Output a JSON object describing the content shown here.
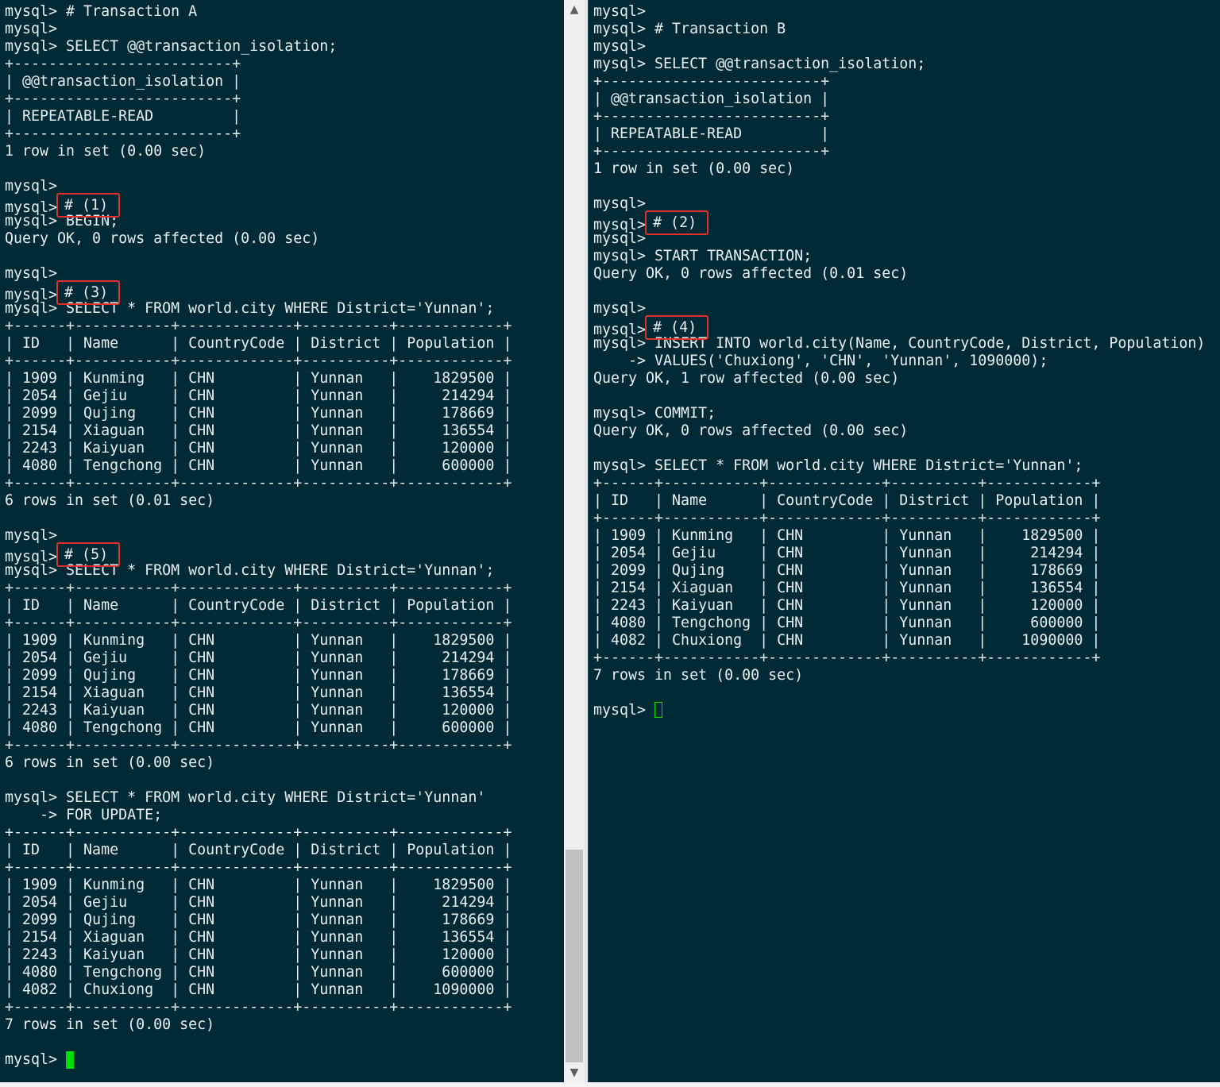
{
  "left_terminal": {
    "lines": [
      {
        "t": "mysql> # Transaction A"
      },
      {
        "t": "mysql>"
      },
      {
        "t": "mysql> SELECT @@transaction_isolation;"
      },
      {
        "t": "+-------------------------+"
      },
      {
        "t": "| @@transaction_isolation |"
      },
      {
        "t": "+-------------------------+"
      },
      {
        "t": "| REPEATABLE-READ         |"
      },
      {
        "t": "+-------------------------+"
      },
      {
        "t": "1 row in set (0.00 sec)"
      },
      {
        "t": ""
      },
      {
        "t": "mysql>"
      },
      {
        "t": "mysql>",
        "marker": "# (1)"
      },
      {
        "t": "mysql> BEGIN;"
      },
      {
        "t": "Query OK, 0 rows affected (0.00 sec)"
      },
      {
        "t": ""
      },
      {
        "t": "mysql>"
      },
      {
        "t": "mysql>",
        "marker": "# (3)"
      },
      {
        "t": "mysql> SELECT * FROM world.city WHERE District='Yunnan';"
      },
      {
        "t": "+------+-----------+-------------+----------+------------+"
      },
      {
        "t": "| ID   | Name      | CountryCode | District | Population |"
      },
      {
        "t": "+------+-----------+-------------+----------+------------+"
      },
      {
        "t": "| 1909 | Kunming   | CHN         | Yunnan   |    1829500 |"
      },
      {
        "t": "| 2054 | Gejiu     | CHN         | Yunnan   |     214294 |"
      },
      {
        "t": "| 2099 | Qujing    | CHN         | Yunnan   |     178669 |"
      },
      {
        "t": "| 2154 | Xiaguan   | CHN         | Yunnan   |     136554 |"
      },
      {
        "t": "| 2243 | Kaiyuan   | CHN         | Yunnan   |     120000 |"
      },
      {
        "t": "| 4080 | Tengchong | CHN         | Yunnan   |     600000 |"
      },
      {
        "t": "+------+-----------+-------------+----------+------------+"
      },
      {
        "t": "6 rows in set (0.01 sec)"
      },
      {
        "t": ""
      },
      {
        "t": "mysql>"
      },
      {
        "t": "mysql>",
        "marker": "# (5)"
      },
      {
        "t": "mysql> SELECT * FROM world.city WHERE District='Yunnan';"
      },
      {
        "t": "+------+-----------+-------------+----------+------------+"
      },
      {
        "t": "| ID   | Name      | CountryCode | District | Population |"
      },
      {
        "t": "+------+-----------+-------------+----------+------------+"
      },
      {
        "t": "| 1909 | Kunming   | CHN         | Yunnan   |    1829500 |"
      },
      {
        "t": "| 2054 | Gejiu     | CHN         | Yunnan   |     214294 |"
      },
      {
        "t": "| 2099 | Qujing    | CHN         | Yunnan   |     178669 |"
      },
      {
        "t": "| 2154 | Xiaguan   | CHN         | Yunnan   |     136554 |"
      },
      {
        "t": "| 2243 | Kaiyuan   | CHN         | Yunnan   |     120000 |"
      },
      {
        "t": "| 4080 | Tengchong | CHN         | Yunnan   |     600000 |"
      },
      {
        "t": "+------+-----------+-------------+----------+------------+"
      },
      {
        "t": "6 rows in set (0.00 sec)"
      },
      {
        "t": ""
      },
      {
        "t": "mysql> SELECT * FROM world.city WHERE District='Yunnan'"
      },
      {
        "t": "    -> FOR UPDATE;"
      },
      {
        "t": "+------+-----------+-------------+----------+------------+"
      },
      {
        "t": "| ID   | Name      | CountryCode | District | Population |"
      },
      {
        "t": "+------+-----------+-------------+----------+------------+"
      },
      {
        "t": "| 1909 | Kunming   | CHN         | Yunnan   |    1829500 |"
      },
      {
        "t": "| 2054 | Gejiu     | CHN         | Yunnan   |     214294 |"
      },
      {
        "t": "| 2099 | Qujing    | CHN         | Yunnan   |     178669 |"
      },
      {
        "t": "| 2154 | Xiaguan   | CHN         | Yunnan   |     136554 |"
      },
      {
        "t": "| 2243 | Kaiyuan   | CHN         | Yunnan   |     120000 |"
      },
      {
        "t": "| 4080 | Tengchong | CHN         | Yunnan   |     600000 |"
      },
      {
        "t": "| 4082 | Chuxiong  | CHN         | Yunnan   |    1090000 |"
      },
      {
        "t": "+------+-----------+-------------+----------+------------+"
      },
      {
        "t": "7 rows in set (0.00 sec)"
      },
      {
        "t": ""
      },
      {
        "t": "mysql> ",
        "cursor": "block"
      }
    ]
  },
  "right_terminal": {
    "lines": [
      {
        "t": "mysql>"
      },
      {
        "t": "mysql> # Transaction B"
      },
      {
        "t": "mysql>"
      },
      {
        "t": "mysql> SELECT @@transaction_isolation;"
      },
      {
        "t": "+-------------------------+"
      },
      {
        "t": "| @@transaction_isolation |"
      },
      {
        "t": "+-------------------------+"
      },
      {
        "t": "| REPEATABLE-READ         |"
      },
      {
        "t": "+-------------------------+"
      },
      {
        "t": "1 row in set (0.00 sec)"
      },
      {
        "t": ""
      },
      {
        "t": "mysql>"
      },
      {
        "t": "mysql>",
        "marker": "# (2)"
      },
      {
        "t": "mysql>"
      },
      {
        "t": "mysql> START TRANSACTION;"
      },
      {
        "t": "Query OK, 0 rows affected (0.01 sec)"
      },
      {
        "t": ""
      },
      {
        "t": "mysql>"
      },
      {
        "t": "mysql>",
        "marker": "# (4)"
      },
      {
        "t": "mysql> INSERT INTO world.city(Name, CountryCode, District, Population)"
      },
      {
        "t": "    -> VALUES('Chuxiong', 'CHN', 'Yunnan', 1090000);"
      },
      {
        "t": "Query OK, 1 row affected (0.00 sec)"
      },
      {
        "t": ""
      },
      {
        "t": "mysql> COMMIT;"
      },
      {
        "t": "Query OK, 0 rows affected (0.00 sec)"
      },
      {
        "t": ""
      },
      {
        "t": "mysql> SELECT * FROM world.city WHERE District='Yunnan';"
      },
      {
        "t": "+------+-----------+-------------+----------+------------+"
      },
      {
        "t": "| ID   | Name      | CountryCode | District | Population |"
      },
      {
        "t": "+------+-----------+-------------+----------+------------+"
      },
      {
        "t": "| 1909 | Kunming   | CHN         | Yunnan   |    1829500 |"
      },
      {
        "t": "| 2054 | Gejiu     | CHN         | Yunnan   |     214294 |"
      },
      {
        "t": "| 2099 | Qujing    | CHN         | Yunnan   |     178669 |"
      },
      {
        "t": "| 2154 | Xiaguan   | CHN         | Yunnan   |     136554 |"
      },
      {
        "t": "| 2243 | Kaiyuan   | CHN         | Yunnan   |     120000 |"
      },
      {
        "t": "| 4080 | Tengchong | CHN         | Yunnan   |     600000 |"
      },
      {
        "t": "| 4082 | Chuxiong  | CHN         | Yunnan   |    1090000 |"
      },
      {
        "t": "+------+-----------+-------------+----------+------------+"
      },
      {
        "t": "7 rows in set (0.00 sec)"
      },
      {
        "t": ""
      },
      {
        "t": "mysql> ",
        "cursor": "hollow"
      }
    ]
  },
  "scrollbar": {
    "up_icon": "▲",
    "down_icon": "▼"
  },
  "colors": {
    "terminal_bg": "#002b36",
    "terminal_fg": "#e9eef0",
    "marker_border": "#e0302a",
    "cursor": "#00e000"
  }
}
